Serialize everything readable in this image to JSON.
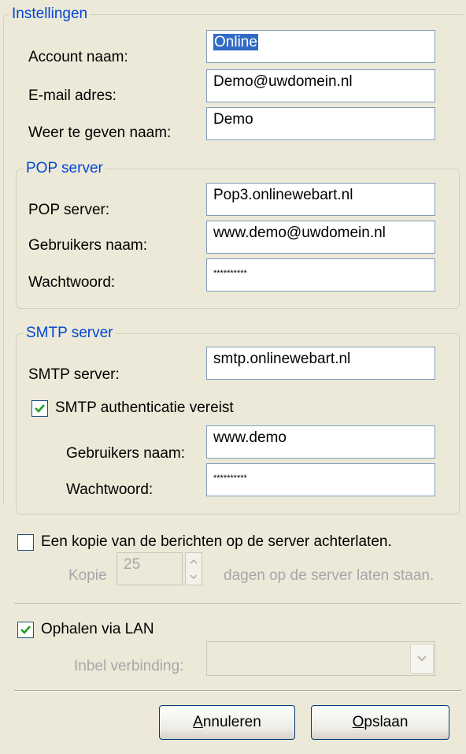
{
  "settings": {
    "legend": "Instellingen",
    "account_name_label": "Account naam:",
    "account_name_value": "Online",
    "email_label": "E-mail adres:",
    "email_value": "Demo@uwdomein.nl",
    "display_name_label": "Weer te geven naam:",
    "display_name_value": "Demo"
  },
  "pop": {
    "legend": "POP server",
    "server_label": "POP server:",
    "server_value": "Pop3.onlinewebart.nl",
    "username_label": "Gebruikers naam:",
    "username_value": "www.demo@uwdomein.nl",
    "password_label": "Wachtwoord:",
    "password_value": "**********"
  },
  "smtp": {
    "legend": "SMTP server",
    "server_label": "SMTP server:",
    "server_value": "smtp.onlinewebart.nl",
    "auth_label": "SMTP authenticatie vereist",
    "auth_checked": true,
    "username_label": "Gebruikers naam:",
    "username_value": "www.demo",
    "password_label": "Wachtwoord:",
    "password_value": "**********"
  },
  "copy": {
    "leave_copy_label": "Een kopie van de berichten op de server achterlaten.",
    "leave_copy_checked": false,
    "kopie_label": "Kopie",
    "days_value": "25",
    "days_suffix": "dagen op de server laten staan."
  },
  "lan": {
    "fetch_label": "Ophalen via LAN",
    "fetch_checked": true,
    "dialup_label": "Inbel verbinding:",
    "dialup_value": ""
  },
  "buttons": {
    "cancel_accel": "A",
    "cancel_rest": "nnuleren",
    "save_accel": "O",
    "save_rest": "pslaan"
  },
  "icons": {
    "check": "checkmark-icon",
    "spin_up": "chevron-up-icon",
    "spin_down": "chevron-down-icon",
    "dropdown": "chevron-down-icon"
  },
  "colors": {
    "background": "#ece9d8",
    "legend": "#0046d5",
    "selection": "#316ac5",
    "check": "#21a121",
    "button_border": "#003c74"
  }
}
